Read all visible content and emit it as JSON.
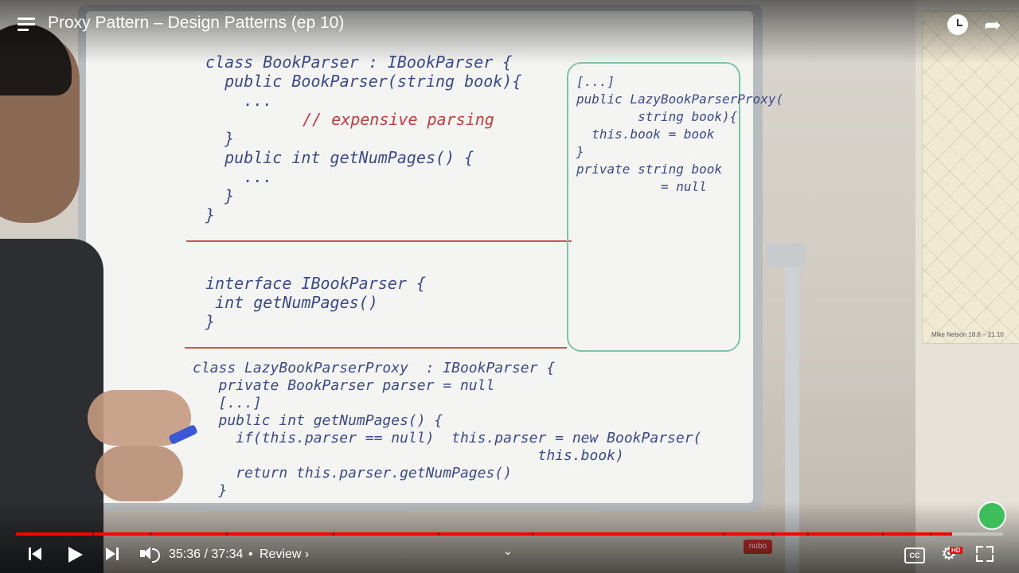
{
  "header": {
    "title": "Proxy Pattern – Design Patterns (ep 10)"
  },
  "controls": {
    "current_time": "35:36",
    "duration": "37:34",
    "separator": "•",
    "chapter": "Review ›",
    "cc_label": "CC",
    "hd_label": "HD",
    "progress": 0.948
  },
  "scene": {
    "brand": "nobo",
    "poster_caption": "Mike Nelson  18.8 – 21.10"
  },
  "whiteboard": {
    "left_code": "class BookParser : IBookParser {\n  public BookParser(string book){\n    ...",
    "left_comment": "// expensive parsing",
    "left_code_2": "  }\n  public int getNumPages() {\n    ...\n  }\n}",
    "interface_code": "interface IBookParser {\n int getNumPages()\n}",
    "proxy_code": "class LazyBookParserProxy  : IBookParser {\n   private BookParser parser = null\n   [...]\n   public int getNumPages() {\n     if(this.parser == null)  this.parser = new BookParser(\n                                        this.book)\n     return this.parser.getNumPages()\n   }",
    "right_code": "[...]\npublic LazyBookParserProxy(\n        string book){\n  this.book = book\n}\nprivate string book\n           = null"
  },
  "colors": {
    "progress": "#ff0000",
    "marker_blue": "#3b4a8c",
    "marker_red": "#c83a3a",
    "marker_green": "#3a8a6b"
  },
  "icons": [
    "menu-icon",
    "clock-icon",
    "share-icon",
    "prev-icon",
    "play-icon",
    "next-icon",
    "volume-icon",
    "chevron-up-icon",
    "cc-icon",
    "settings-icon",
    "fullscreen-icon"
  ]
}
